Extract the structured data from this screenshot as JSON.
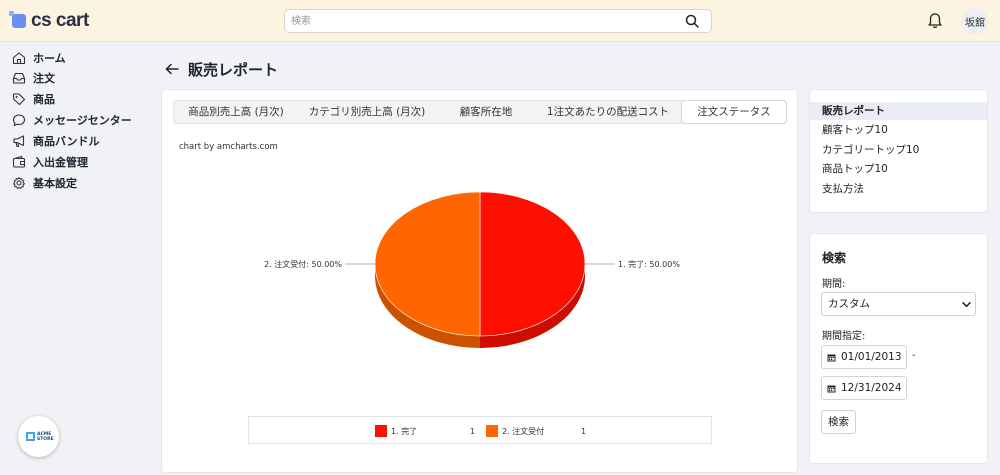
{
  "app": {
    "logo_text": "cs cart"
  },
  "topbar": {
    "search_placeholder": "検索",
    "avatar_text": "坂舘"
  },
  "sidebar": {
    "items": [
      {
        "label": "ホーム",
        "icon": "home-icon"
      },
      {
        "label": "注文",
        "icon": "inbox-icon"
      },
      {
        "label": "商品",
        "icon": "tag-icon"
      },
      {
        "label": "メッセージセンター",
        "icon": "chat-icon"
      },
      {
        "label": "商品バンドル",
        "icon": "megaphone-icon"
      },
      {
        "label": "入出金管理",
        "icon": "wallet-icon"
      },
      {
        "label": "基本設定",
        "icon": "gear-icon"
      }
    ],
    "store_badge": "ACME STORE"
  },
  "page": {
    "title": "販売レポート"
  },
  "tabs": [
    {
      "label": "商品別売上高 (月次)"
    },
    {
      "label": "カテゴリ別売上高 (月次)"
    },
    {
      "label": "顧客所在地"
    },
    {
      "label": "1注文あたりの配送コスト"
    },
    {
      "label": "注文ステータス",
      "active": true
    }
  ],
  "chart_credit": "chart by amcharts.com",
  "chart_data": {
    "type": "pie",
    "style": "3d",
    "slices": [
      {
        "name": "1. 完了",
        "value": 1,
        "percent": 50.0,
        "color": "#ff0f00",
        "label": "1. 完了: 50.00%"
      },
      {
        "name": "2. 注文受付",
        "value": 1,
        "percent": 50.0,
        "color": "#ff6600",
        "label": "2. 注文受付: 50.00%"
      }
    ],
    "legend_placement": "bottom"
  },
  "reports": {
    "items": [
      {
        "label": "販売レポート",
        "active": true
      },
      {
        "label": "顧客トップ10"
      },
      {
        "label": "カテゴリートップ10"
      },
      {
        "label": "商品トップ10"
      },
      {
        "label": "支払方法"
      }
    ]
  },
  "search_panel": {
    "title": "検索",
    "period_label": "期間:",
    "period_value": "カスタム",
    "range_label": "期間指定:",
    "date_from": "01/01/2013",
    "dash": "-",
    "date_to": "12/31/2024",
    "button_label": "検索"
  }
}
